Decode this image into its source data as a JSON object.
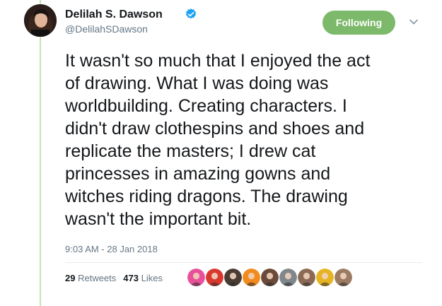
{
  "author": {
    "name": "Delilah S. Dawson",
    "handle": "@DelilahSDawson",
    "verified": true
  },
  "follow_button": {
    "label": "Following",
    "color": "#7cb96a"
  },
  "tweet": {
    "lines": [
      "It wasn't so much that I enjoyed the act",
      "of drawing. What I was doing was",
      "worldbuilding. Creating characters. I",
      "didn't draw clothespins and shoes and",
      "replicate the masters; I drew cat",
      "princesses in amazing gowns and",
      "witches riding dragons. The drawing",
      "wasn't the important bit."
    ],
    "timestamp": "9:03 AM - 28 Jan 2018"
  },
  "stats": {
    "retweets_count": "29",
    "retweets_label": "Retweets",
    "likes_count": "473",
    "likes_label": "Likes"
  },
  "likers": [
    {
      "icon": "avatar-pink-cartoon",
      "color": "#e8519a"
    },
    {
      "icon": "avatar-red-patterned",
      "color": "#d9382f"
    },
    {
      "icon": "avatar-dark-figure",
      "color": "#4a3b33"
    },
    {
      "icon": "avatar-orange-rebel",
      "color": "#f28a1c"
    },
    {
      "icon": "avatar-woman-dark-hair",
      "color": "#6b4a3a"
    },
    {
      "icon": "avatar-grey-photo",
      "color": "#7f868c"
    },
    {
      "icon": "avatar-woman-glasses",
      "color": "#8b6a55"
    },
    {
      "icon": "avatar-sunflower",
      "color": "#e6b422"
    },
    {
      "icon": "avatar-woman-light-hair",
      "color": "#9c7b63"
    }
  ],
  "colors": {
    "thread_line": "#c4e2b8",
    "verified_badge": "#1da1f2",
    "secondary_text": "#657786"
  }
}
